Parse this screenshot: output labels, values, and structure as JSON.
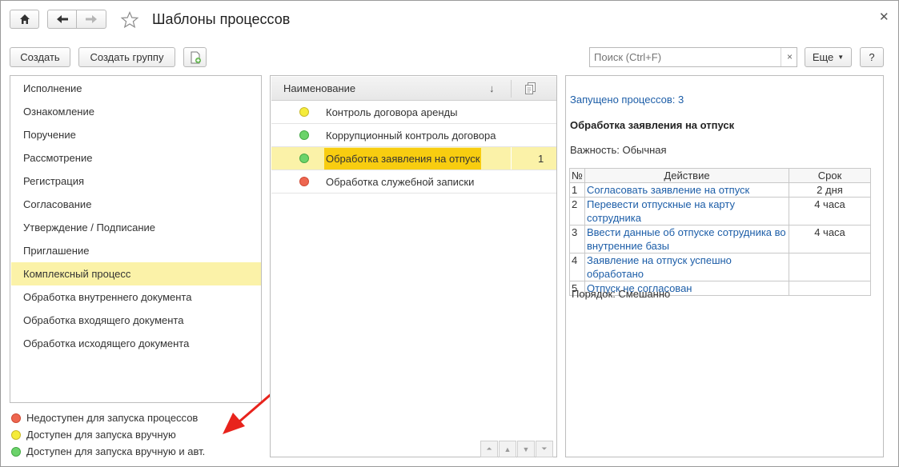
{
  "window": {
    "title": "Шаблоны процессов",
    "close_icon": "close-icon"
  },
  "toolbar": {
    "create_label": "Создать",
    "create_group_label": "Создать группу",
    "search_placeholder": "Поиск (Ctrl+F)",
    "search_clear": "×",
    "more_label": "Еще",
    "help_label": "?"
  },
  "left_list": {
    "items": [
      {
        "label": "Исполнение"
      },
      {
        "label": "Ознакомление"
      },
      {
        "label": "Поручение"
      },
      {
        "label": "Рассмотрение"
      },
      {
        "label": "Регистрация"
      },
      {
        "label": "Согласование"
      },
      {
        "label": "Утверждение / Подписание"
      },
      {
        "label": "Приглашение"
      },
      {
        "label": "Комплексный процесс",
        "selected": true
      },
      {
        "label": "Обработка внутреннего документа"
      },
      {
        "label": "Обработка входящего документа"
      },
      {
        "label": "Обработка исходящего документа"
      }
    ]
  },
  "legend": {
    "items": [
      {
        "label": "Недоступен для запуска процессов",
        "color": "#ee6650"
      },
      {
        "label": "Доступен для запуска вручную",
        "color": "#f5ec3a"
      },
      {
        "label": "Доступен для запуска вручную и авт.",
        "color": "#6cd36b"
      }
    ]
  },
  "templates_table": {
    "header_name": "Наименование",
    "sort_icon": "↓",
    "rows": [
      {
        "name": "Контроль договора аренды",
        "status": "yellow",
        "count": ""
      },
      {
        "name": "Коррупционный контроль договора",
        "status": "green",
        "count": ""
      },
      {
        "name": "Обработка заявления на отпуск",
        "status": "green",
        "count": "1",
        "selected": true
      },
      {
        "name": "Обработка служебной записки",
        "status": "red",
        "count": ""
      }
    ]
  },
  "details": {
    "launched": "Запущено процессов: 3",
    "title": "Обработка заявления на отпуск",
    "importance": "Важность: Обычная",
    "col_num": "№",
    "col_action": "Действие",
    "col_term": "Срок",
    "actions": [
      {
        "num": "1",
        "action": "Согласовать заявление на отпуск",
        "term": "2 дня"
      },
      {
        "num": "2",
        "action": "Перевести отпускные на карту сотрудника",
        "term": "4 часа"
      },
      {
        "num": "3",
        "action": "Ввести данные об отпуске сотрудника во внутренние базы",
        "term": "4 часа"
      },
      {
        "num": "4",
        "action": "Заявление на отпуск успешно обработано",
        "term": ""
      },
      {
        "num": "5",
        "action": "Отпуск не согласован",
        "term": ""
      }
    ],
    "order": "Порядок: Смешанно"
  }
}
